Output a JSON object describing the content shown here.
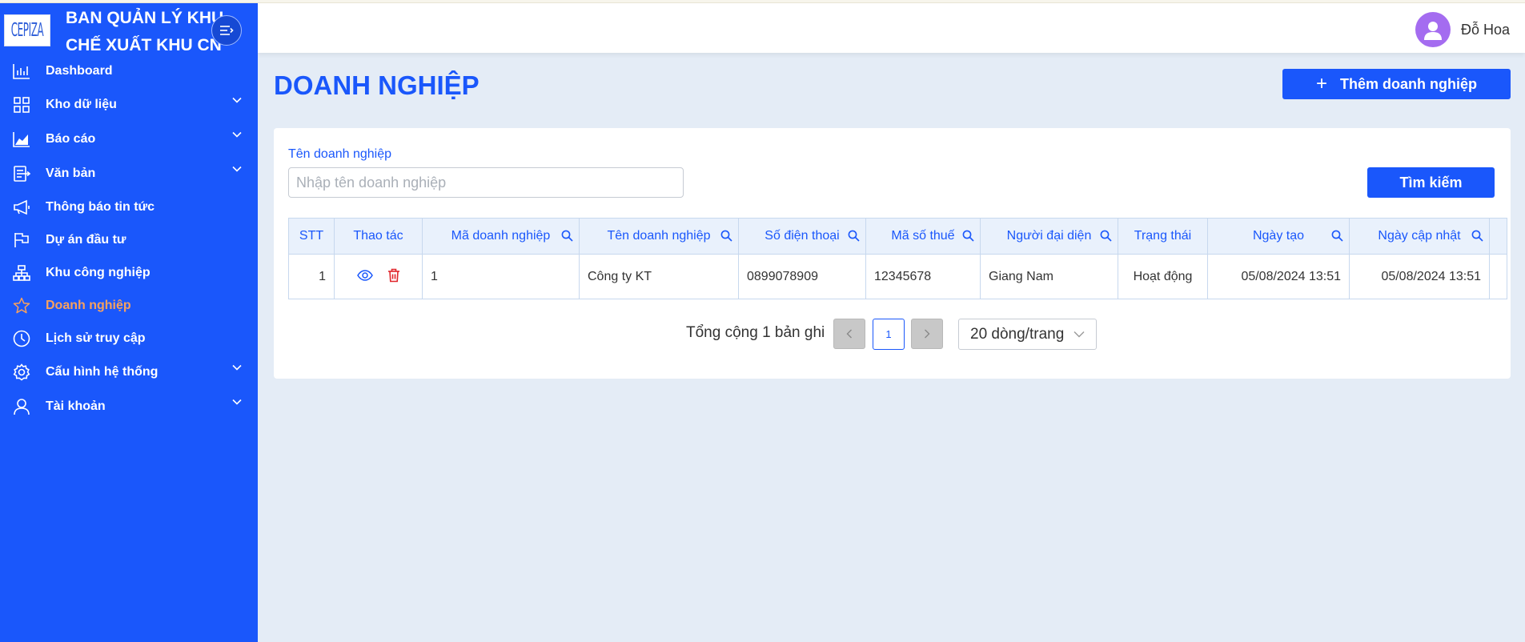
{
  "brand": {
    "logo_text": "CEPIZA",
    "title_line1": "BAN QUẢN LÝ KHU",
    "title_line2": "CHẾ XUẤT KHU CN"
  },
  "sidebar": {
    "items": [
      {
        "label": "Dashboard",
        "icon": "bar-chart-icon",
        "has_submenu": false,
        "active": false
      },
      {
        "label": "Kho dữ liệu",
        "icon": "grid-icon",
        "has_submenu": true,
        "active": false
      },
      {
        "label": "Báo cáo",
        "icon": "area-chart-icon",
        "has_submenu": true,
        "active": false
      },
      {
        "label": "Văn bản",
        "icon": "document-icon",
        "has_submenu": true,
        "active": false
      },
      {
        "label": "Thông báo tin tức",
        "icon": "megaphone-icon",
        "has_submenu": false,
        "active": false
      },
      {
        "label": "Dự án đầu tư",
        "icon": "flag-icon",
        "has_submenu": false,
        "active": false
      },
      {
        "label": "Khu công nghiệp",
        "icon": "cluster-icon",
        "has_submenu": false,
        "active": false
      },
      {
        "label": "Doanh nghiệp",
        "icon": "star-icon",
        "has_submenu": false,
        "active": true
      },
      {
        "label": "Lịch sử truy cập",
        "icon": "clock-icon",
        "has_submenu": false,
        "active": false
      },
      {
        "label": "Cấu hình hệ thống",
        "icon": "gear-icon",
        "has_submenu": true,
        "active": false
      },
      {
        "label": "Tài khoản",
        "icon": "user-icon",
        "has_submenu": true,
        "active": false
      }
    ]
  },
  "header": {
    "user_name": "Đỗ Hoa"
  },
  "main": {
    "title": "DOANH NGHIỆP",
    "add_button": "Thêm doanh nghiệp",
    "filter": {
      "label": "Tên doanh nghiệp",
      "placeholder": "Nhập tên doanh nghiệp",
      "value": ""
    },
    "search_button": "Tìm kiếm",
    "table": {
      "columns": [
        "STT",
        "Thao tác",
        "Mã doanh nghiệp",
        "Tên doanh nghiệp",
        "Số điện thoại",
        "Mã số thuế",
        "Người đại diện",
        "Trạng thái",
        "Ngày tạo",
        "Ngày cập nhật"
      ],
      "rows": [
        {
          "stt": "1",
          "code": "1",
          "name": "Công ty KT",
          "phone": "0899078909",
          "tax": "12345678",
          "rep": "Giang Nam",
          "status": "Hoạt động",
          "created": "05/08/2024 13:51",
          "updated": "05/08/2024 13:51"
        }
      ]
    },
    "pagination": {
      "total_text": "Tổng cộng 1 bản ghi",
      "current_page": "1",
      "page_size": "20 dòng/trang"
    }
  },
  "colors": {
    "primary": "#1a57fb",
    "active_menu": "#f7a15e",
    "status_active": "#2aa23a",
    "avatar": "#a46cf0"
  }
}
